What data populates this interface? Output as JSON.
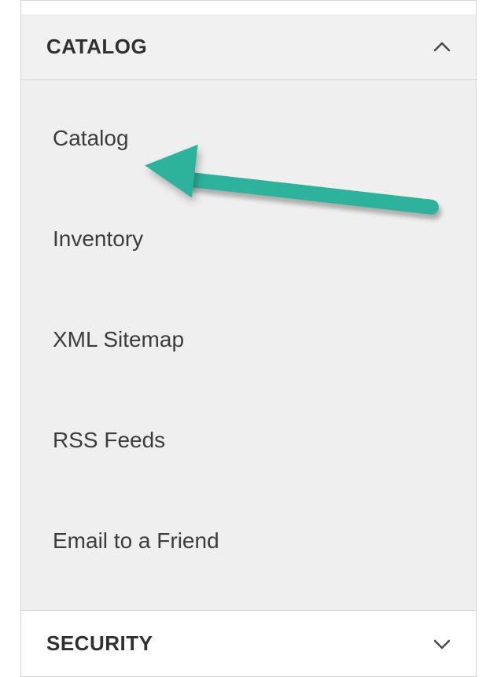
{
  "sections": {
    "catalog": {
      "title": "CATALOG",
      "expanded": true,
      "items": [
        {
          "label": "Catalog"
        },
        {
          "label": "Inventory"
        },
        {
          "label": "XML Sitemap"
        },
        {
          "label": "RSS Feeds"
        },
        {
          "label": "Email to a Friend"
        }
      ]
    },
    "security": {
      "title": "SECURITY",
      "expanded": false
    }
  },
  "annotation": {
    "type": "arrow",
    "color": "#2db39b",
    "points_to": "Catalog"
  }
}
